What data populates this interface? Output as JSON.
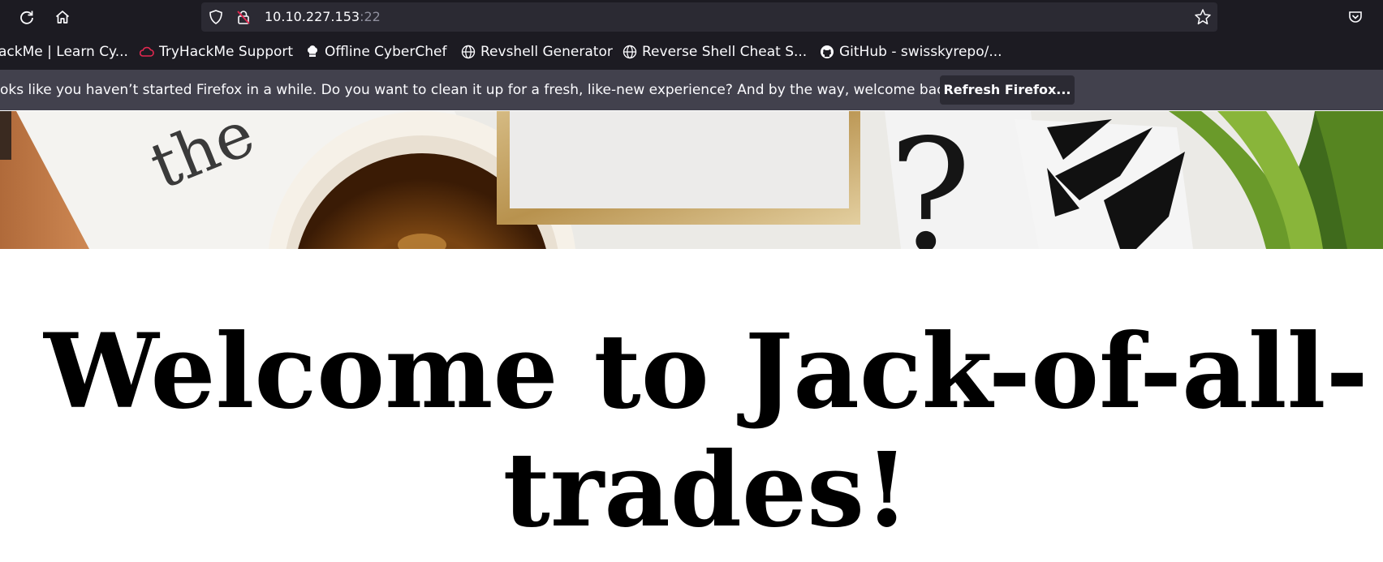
{
  "browser": {
    "url_host": "10.10.227.153",
    "url_port": ":22",
    "toolbar_icons": [
      "reload-icon",
      "home-icon",
      "shield-icon",
      "insecure-lock-icon",
      "bookmark-star-icon",
      "pocket-icon"
    ]
  },
  "bookmarks": [
    {
      "label": "ackMe | Learn Cy...",
      "icon": "favicon"
    },
    {
      "label": "TryHackMe Support",
      "icon": "cloud-icon"
    },
    {
      "label": "Offline CyberChef",
      "icon": "chef-hat-icon"
    },
    {
      "label": "Revshell Generator",
      "icon": "globe-icon"
    },
    {
      "label": "Reverse Shell Cheat S...",
      "icon": "globe-icon"
    },
    {
      "label": "GitHub - swisskyrepo/...",
      "icon": "github-icon"
    }
  ],
  "notification": {
    "message": "oks like you haven’t started Firefox in a while. Do you want to clean it up for a fresh, like-new experience? And by the way, welcome back!",
    "button_label": "Refresh Firefox..."
  },
  "page": {
    "heading": "Welcome to Jack-of-all-trades!"
  },
  "colors": {
    "chrome_bg": "#1c1b22",
    "urlbar_bg": "#2b2a33",
    "notification_bg": "#42414d",
    "page_bg": "#ffffff",
    "heading_color": "#000000"
  }
}
